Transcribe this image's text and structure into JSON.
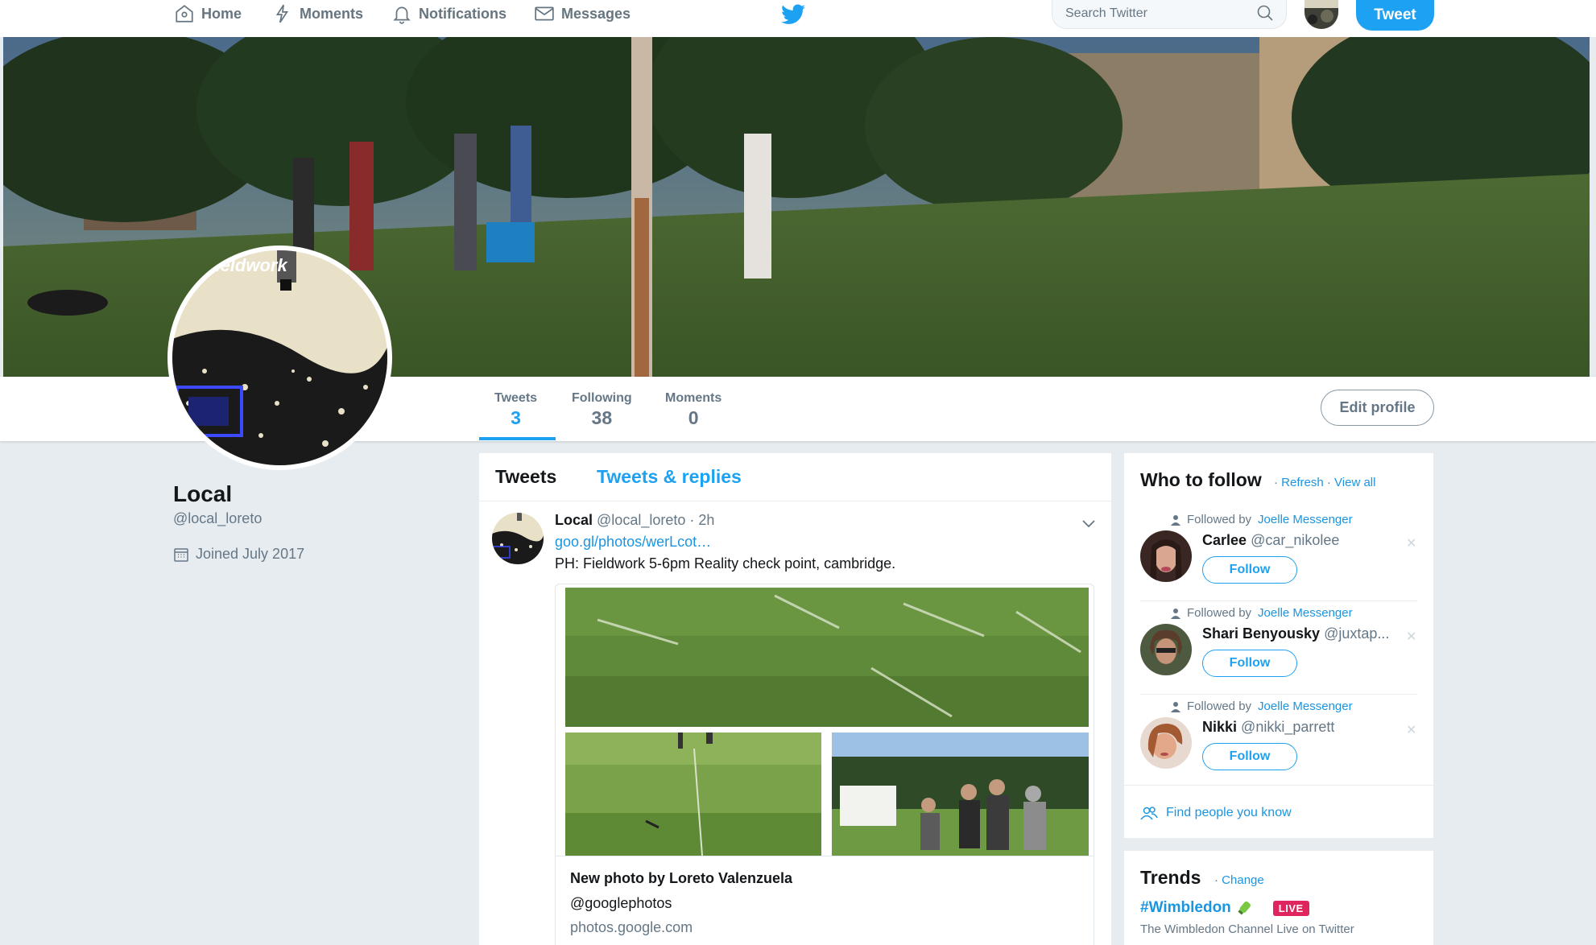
{
  "nav": {
    "items": [
      {
        "label": "Home",
        "icon": "home-icon"
      },
      {
        "label": "Moments",
        "icon": "lightning-icon"
      },
      {
        "label": "Notifications",
        "icon": "bell-icon"
      },
      {
        "label": "Messages",
        "icon": "envelope-icon"
      }
    ],
    "search_placeholder": "Search Twitter",
    "tweet_button": "Tweet",
    "brand_color": "#1da1f2"
  },
  "banner": {
    "overlay_text": "Fieldwork"
  },
  "profile_nav": {
    "stats": [
      {
        "label": "Tweets",
        "value": "3",
        "active": true
      },
      {
        "label": "Following",
        "value": "38",
        "active": false
      },
      {
        "label": "Moments",
        "value": "0",
        "active": false
      }
    ],
    "edit_button": "Edit profile"
  },
  "profile": {
    "name": "Local",
    "handle": "@local_loreto",
    "joined": "Joined July 2017"
  },
  "timeline": {
    "tabs": [
      {
        "label": "Tweets",
        "active": true
      },
      {
        "label": "Tweets & replies",
        "active": false
      }
    ],
    "tweet": {
      "author_name": "Local",
      "author_handle": "@local_loreto",
      "time": "· 2h",
      "link": "goo.gl/photos/werLcot…",
      "text": "PH: Fieldwork 5-6pm Reality check point, cambridge.",
      "card": {
        "title": "New photo by Loreto Valenzuela",
        "subtitle": "@googlephotos",
        "url": "photos.google.com"
      }
    }
  },
  "who_to_follow": {
    "title": "Who to follow",
    "refresh": "Refresh",
    "view_all": "View all",
    "followed_by_prefix": "Followed by",
    "follow_label": "Follow",
    "suggestions": [
      {
        "followed_by": "Joelle Messenger",
        "name": "Carlee",
        "handle": "@car_nikolee"
      },
      {
        "followed_by": "Joelle Messenger",
        "name": "Shari Benyousky",
        "handle": "@juxtap..."
      },
      {
        "followed_by": "Joelle Messenger",
        "name": "Nikki",
        "handle": "@nikki_parrett"
      }
    ],
    "find_people": "Find people you know"
  },
  "trends": {
    "title": "Trends",
    "change": "Change",
    "items": [
      {
        "tag": "#Wimbledon",
        "badge": "LIVE",
        "description": "The Wimbledon Channel Live on Twitter"
      }
    ]
  }
}
